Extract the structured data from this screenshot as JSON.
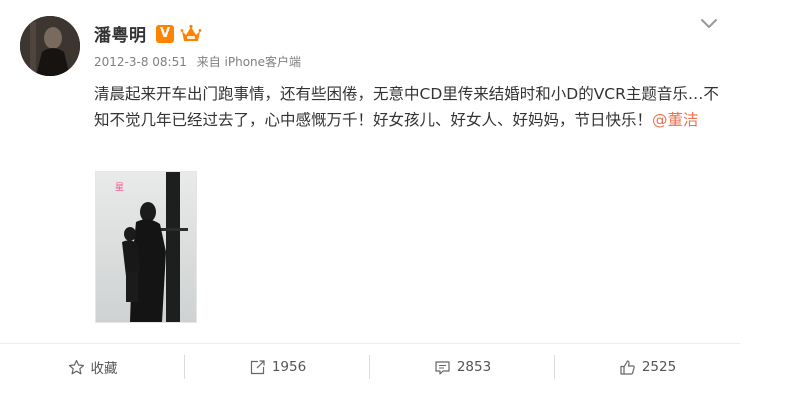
{
  "post": {
    "author": {
      "name": "潘粤明",
      "verified_badge": "V"
    },
    "meta": {
      "timestamp": "2012-3-8 08:51",
      "source": "来自 iPhone客户端"
    },
    "text": {
      "main": "清晨起来开车出门跑事情，还有些困倦，无意中CD里传来结婚时和小D的VCR主题音乐…不知不觉几年已经过去了，心中感慨万千！好女孩儿、好女人、好妈妈，节日快乐！",
      "mention": "@董洁"
    },
    "image": {
      "label": "星"
    }
  },
  "actions": {
    "favorite": {
      "label": "收藏"
    },
    "repost": {
      "count": "1956"
    },
    "comment": {
      "count": "2853"
    },
    "like": {
      "count": "2525"
    }
  },
  "colors": {
    "accent": "#eb7350",
    "vip": "#ff8200",
    "badge_label": "#ff4f8b"
  }
}
